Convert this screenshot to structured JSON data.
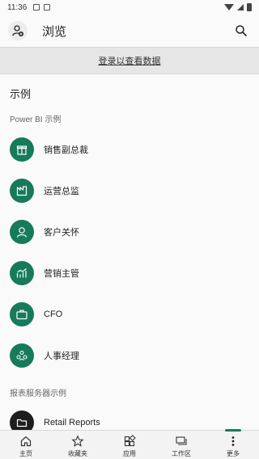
{
  "status_bar": {
    "time": "11:36"
  },
  "header": {
    "title": "浏览",
    "avatar_icon": "person-add-icon",
    "search_icon": "search-icon"
  },
  "banner": {
    "link_text": "登录以查看数据"
  },
  "section": {
    "title": "示例"
  },
  "groups": {
    "powerbi_label": "Power BI 示例",
    "reporting_label": "报表服务器示例"
  },
  "samples": [
    {
      "label": "销售副总裁",
      "icon": "gift-icon"
    },
    {
      "label": "运营总监",
      "icon": "factory-icon"
    },
    {
      "label": "客户关怀",
      "icon": "user-icon"
    },
    {
      "label": "营销主管",
      "icon": "trend-chart-icon"
    },
    {
      "label": "CFO",
      "icon": "briefcase-icon"
    },
    {
      "label": "人事经理",
      "icon": "people-icon"
    }
  ],
  "reporting_samples": [
    {
      "label": "Retail Reports",
      "icon": "folder-icon"
    }
  ],
  "bottom_nav": [
    {
      "label": "主页",
      "icon": "home-icon"
    },
    {
      "label": "收藏夹",
      "icon": "star-icon"
    },
    {
      "label": "应用",
      "icon": "apps-icon"
    },
    {
      "label": "工作区",
      "icon": "workspaces-icon"
    },
    {
      "label": "更多",
      "icon": "more-icon"
    }
  ],
  "colors": {
    "accent": "#167a5b",
    "banner_bg": "#e6e6e6"
  }
}
